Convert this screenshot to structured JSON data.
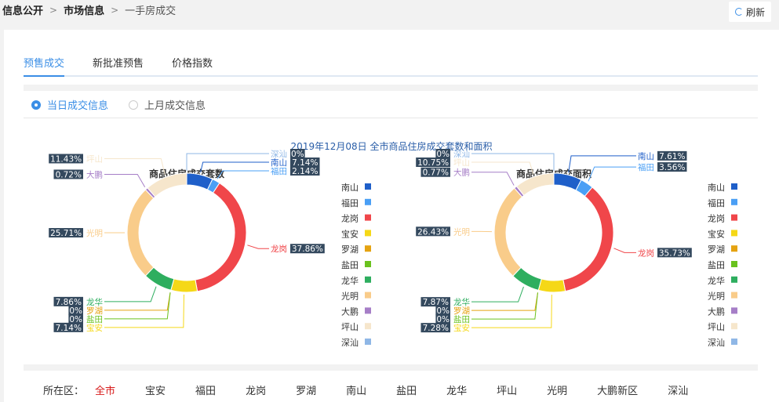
{
  "breadcrumb": {
    "items": [
      "信息公开",
      "市场信息",
      "一手房成交"
    ]
  },
  "refresh": {
    "label": "刷新"
  },
  "tabs": [
    {
      "label": "预售成交",
      "active": true
    },
    {
      "label": "新批准预售",
      "active": false
    },
    {
      "label": "价格指数",
      "active": false
    }
  ],
  "radios": [
    {
      "label": "当日成交信息",
      "active": true
    },
    {
      "label": "上月成交信息",
      "active": false
    }
  ],
  "main_title": "2019年12月08日 全市商品住房成交套数和面积",
  "districts": {
    "label": "所在区：",
    "items": [
      "全市",
      "宝安",
      "福田",
      "龙岗",
      "罗湖",
      "南山",
      "盐田",
      "龙华",
      "坪山",
      "光明",
      "大鹏新区",
      "深汕"
    ],
    "active": "全市"
  },
  "colors": {
    "南山": "#1f5fc9",
    "福田": "#4a9ff5",
    "龙岗": "#f0464a",
    "宝安": "#f5d817",
    "罗湖": "#e5a311",
    "盐田": "#6ac21e",
    "龙华": "#2eae5f",
    "光明": "#f9cc8a",
    "大鹏": "#a67ec7",
    "坪山": "#f6e6cc",
    "深汕": "#8fb7e6"
  },
  "chart_data": [
    {
      "type": "pie",
      "title": "商品住房成交套数",
      "categories": [
        "南山",
        "福田",
        "龙岗",
        "宝安",
        "罗湖",
        "盐田",
        "龙华",
        "光明",
        "大鹏",
        "坪山",
        "深汕"
      ],
      "values": [
        7.14,
        2.14,
        37.86,
        7.14,
        0,
        0,
        7.86,
        25.71,
        0.72,
        11.43,
        0
      ],
      "labels": [
        "7.14%",
        "2.14%",
        "37.86%",
        "7.14%",
        "0%",
        "0%",
        "7.86%",
        "25.71%",
        "0.72%",
        "11.43%",
        "0%"
      ],
      "legend": [
        "南山",
        "福田",
        "龙岗",
        "宝安",
        "罗湖",
        "盐田",
        "龙华",
        "光明",
        "大鹏",
        "坪山",
        "深汕"
      ],
      "legend_position": "right"
    },
    {
      "type": "pie",
      "title": "商品住房成交面积",
      "categories": [
        "南山",
        "福田",
        "龙岗",
        "宝安",
        "罗湖",
        "盐田",
        "龙华",
        "光明",
        "大鹏",
        "坪山",
        "深汕"
      ],
      "values": [
        7.61,
        3.56,
        35.73,
        7.28,
        0,
        0,
        7.87,
        26.43,
        0.77,
        10.75,
        0
      ],
      "labels": [
        "7.61%",
        "3.56%",
        "35.73%",
        "7.28%",
        "0%",
        "0%",
        "7.87%",
        "26.43%",
        "0.77%",
        "10.75%",
        "0%"
      ],
      "legend": [
        "南山",
        "福田",
        "龙岗",
        "宝安",
        "罗湖",
        "盐田",
        "龙华",
        "光明",
        "大鹏",
        "坪山",
        "深汕"
      ],
      "legend_position": "right"
    }
  ]
}
